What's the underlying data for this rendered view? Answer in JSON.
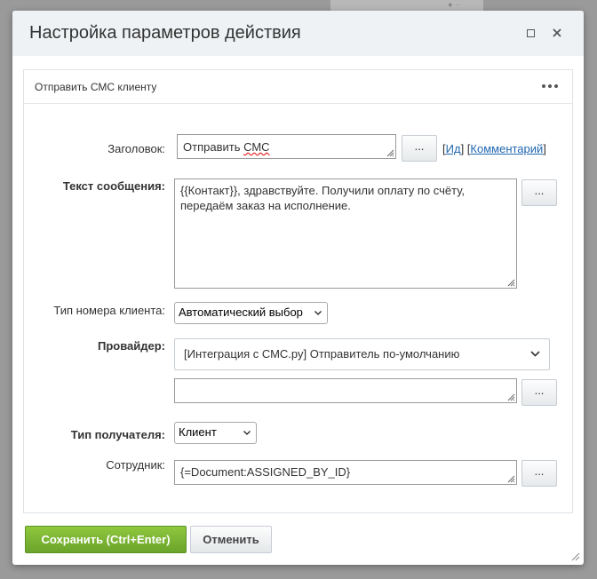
{
  "dialog": {
    "title": "Настройка параметров действия",
    "maximize_icon": "maximize-icon",
    "close_icon": "close-icon"
  },
  "panel": {
    "title": "Отправить СМС клиенту",
    "more_icon": "more-dots-icon"
  },
  "form": {
    "heading": {
      "label": "Заголовок:",
      "value_prefix": "Отправить ",
      "value_misspelled": "СМС",
      "dots_label": "...",
      "links": {
        "id": "Ид",
        "comment": "Комментарий"
      }
    },
    "message": {
      "label": "Текст сообщения:",
      "value": "{{Контакт}}, здравствуйте. Получили оплату по счёту, передаём заказ на исполнение.",
      "dots_label": "..."
    },
    "number_type": {
      "label": "Тип номера клиента:",
      "selected": "Автоматический выбор"
    },
    "provider": {
      "label": "Провайдер:",
      "selected": "[Интеграция с СМС.ру] Отправитель по-умолчанию",
      "extra_value": "",
      "dots_label": "..."
    },
    "recipient_type": {
      "label": "Тип получателя:",
      "selected": "Клиент"
    },
    "employee": {
      "label": "Сотрудник:",
      "value": "{=Document:ASSIGNED_BY_ID}",
      "dots_label": "..."
    }
  },
  "footer": {
    "save_label": "Сохранить (Ctrl+Enter)",
    "cancel_label": "Отменить"
  },
  "colors": {
    "save_green": "#7bb535",
    "link_blue": "#2067b0",
    "header_bg": "#eef2f4"
  }
}
